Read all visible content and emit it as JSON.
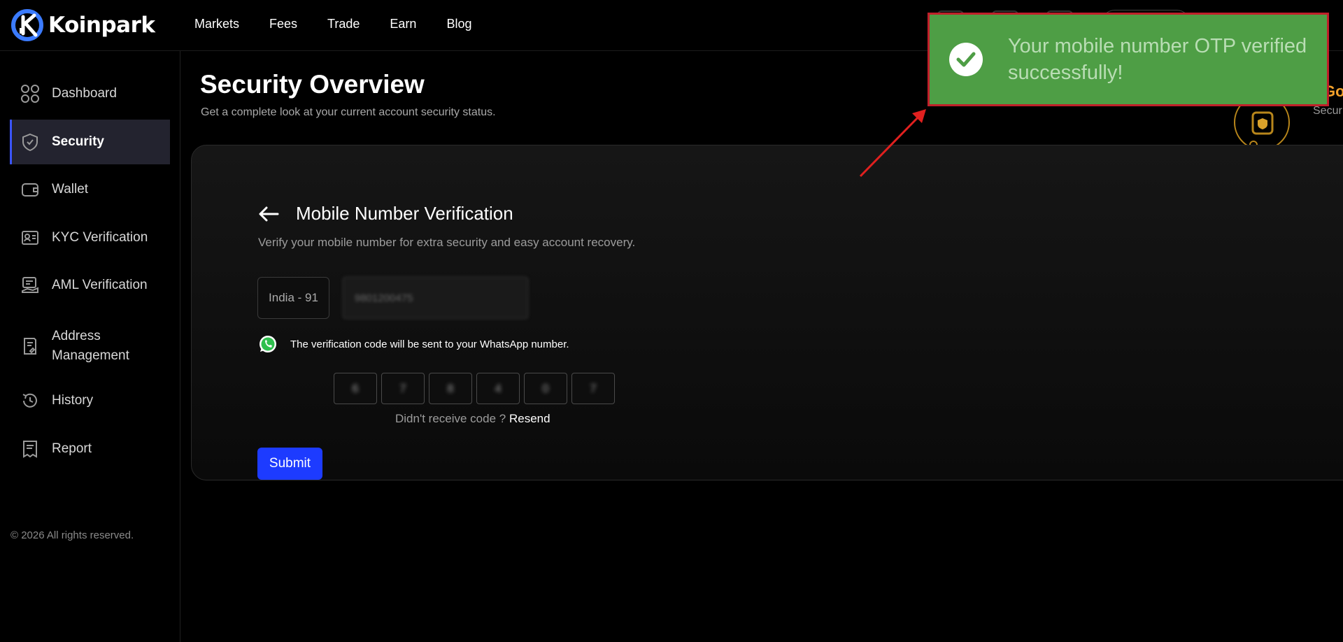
{
  "brand": {
    "name": "Koinpark"
  },
  "nav": {
    "items": [
      {
        "label": "Markets"
      },
      {
        "label": "Fees"
      },
      {
        "label": "Trade"
      },
      {
        "label": "Earn"
      },
      {
        "label": "Blog"
      }
    ]
  },
  "sidebar": {
    "items": [
      {
        "label": "Dashboard",
        "icon": "grid-icon",
        "active": false
      },
      {
        "label": "Security",
        "icon": "shield-icon",
        "active": true
      },
      {
        "label": "Wallet",
        "icon": "wallet-icon",
        "active": false
      },
      {
        "label": "KYC Verification",
        "icon": "id-card-icon",
        "active": false
      },
      {
        "label": "AML Verification",
        "icon": "aml-icon",
        "active": false
      },
      {
        "label": "Address\nManagement",
        "icon": "address-book-icon",
        "active": false
      },
      {
        "label": "History",
        "icon": "history-icon",
        "active": false
      },
      {
        "label": "Report",
        "icon": "report-icon",
        "active": false
      }
    ],
    "copyright": "© 2026 All rights reserved."
  },
  "page": {
    "title": "Security Overview",
    "subtitle": "Get a complete look at your current account security status."
  },
  "verification": {
    "title": "Mobile Number Verification",
    "subtitle": "Verify your mobile number for extra security and easy account recovery.",
    "country": "India - 91",
    "phone_value": "9801200475",
    "whatsapp_note": "The verification code will be sent to your WhatsApp number.",
    "otp_digits": [
      "6",
      "7",
      "8",
      "4",
      "0",
      "7"
    ],
    "resend_prompt": "Didn't receive code ?",
    "resend_link": "Resend",
    "submit_label": "Submit"
  },
  "security_status": {
    "label_top": "Goo",
    "label_bottom": "Secur"
  },
  "toast": {
    "message": "Your mobile number OTP verified successfully!",
    "icon": "check-circle-icon"
  },
  "colors": {
    "accent": "#1d3bff",
    "toast_bg": "#4e9e45",
    "toast_border": "#c0202a",
    "badge_gold": "#b8861b",
    "status_orange": "#f4a12b"
  }
}
